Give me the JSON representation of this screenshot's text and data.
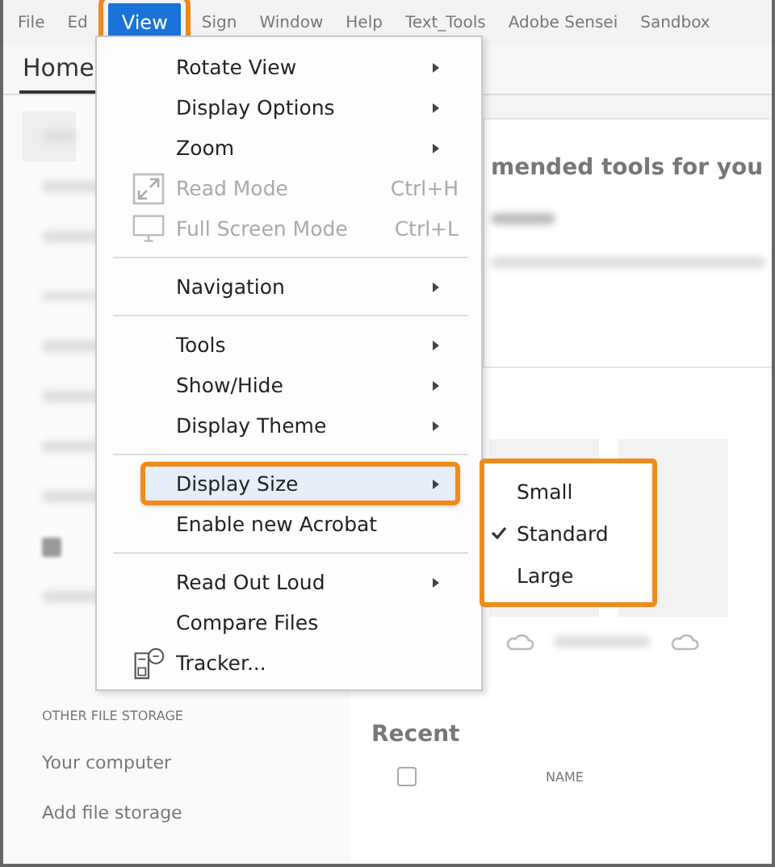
{
  "menubar": [
    {
      "label": "File",
      "selected": false,
      "callout": false
    },
    {
      "label": "Ed",
      "selected": false,
      "callout": false
    },
    {
      "label": "View",
      "selected": true,
      "callout": true
    },
    {
      "label": "Sign",
      "selected": false,
      "callout": false
    },
    {
      "label": "Window",
      "selected": false,
      "callout": false
    },
    {
      "label": "Help",
      "selected": false,
      "callout": false
    },
    {
      "label": "Text_Tools",
      "selected": false,
      "callout": false
    },
    {
      "label": "Adobe Sensei",
      "selected": false,
      "callout": false
    },
    {
      "label": "Sandbox",
      "selected": false,
      "callout": false
    }
  ],
  "tabs": [
    {
      "label": "Home",
      "selected": true
    }
  ],
  "sidebar": {
    "section": "OTHER FILE STORAGE",
    "items": [
      "Your computer",
      "Add file storage"
    ]
  },
  "content": {
    "heading": "mended tools for you",
    "recent_heading": "Recent",
    "column_name": "NAME",
    "select_all_checked": false
  },
  "view_menu": {
    "items": [
      {
        "kind": "submenu",
        "label": "Rotate View",
        "disabled": false,
        "highlighted": false,
        "callout": false
      },
      {
        "kind": "submenu",
        "label": "Display Options",
        "disabled": false,
        "highlighted": false,
        "callout": false
      },
      {
        "kind": "submenu",
        "label": "Zoom",
        "disabled": false,
        "highlighted": false,
        "callout": false
      },
      {
        "kind": "command",
        "label": "Read Mode",
        "shortcut": "Ctrl+H",
        "disabled": true,
        "highlighted": false,
        "callout": false
      },
      {
        "kind": "command",
        "label": "Full Screen Mode",
        "shortcut": "Ctrl+L",
        "disabled": true,
        "highlighted": false,
        "callout": false
      },
      {
        "kind": "separator"
      },
      {
        "kind": "submenu",
        "label": "Navigation",
        "disabled": false,
        "highlighted": false,
        "callout": false
      },
      {
        "kind": "separator"
      },
      {
        "kind": "submenu",
        "label": "Tools",
        "disabled": false,
        "highlighted": false,
        "callout": false
      },
      {
        "kind": "submenu",
        "label": "Show/Hide",
        "disabled": false,
        "highlighted": false,
        "callout": false
      },
      {
        "kind": "submenu",
        "label": "Display Theme",
        "disabled": false,
        "highlighted": false,
        "callout": false
      },
      {
        "kind": "separator"
      },
      {
        "kind": "submenu",
        "label": "Display Size",
        "disabled": false,
        "highlighted": true,
        "callout": true
      },
      {
        "kind": "command",
        "label": "Enable new Acrobat",
        "disabled": false,
        "highlighted": false,
        "callout": false
      },
      {
        "kind": "separator"
      },
      {
        "kind": "submenu",
        "label": "Read Out Loud",
        "disabled": false,
        "highlighted": false,
        "callout": false
      },
      {
        "kind": "command",
        "label": "Compare Files",
        "disabled": false,
        "highlighted": false,
        "callout": false
      },
      {
        "kind": "command",
        "label": "Tracker...",
        "disabled": false,
        "highlighted": false,
        "callout": false
      }
    ]
  },
  "size_submenu": {
    "callout": true,
    "items": [
      {
        "label": "Small",
        "checked": false
      },
      {
        "label": "Standard",
        "checked": true
      },
      {
        "label": "Large",
        "checked": false
      }
    ]
  }
}
